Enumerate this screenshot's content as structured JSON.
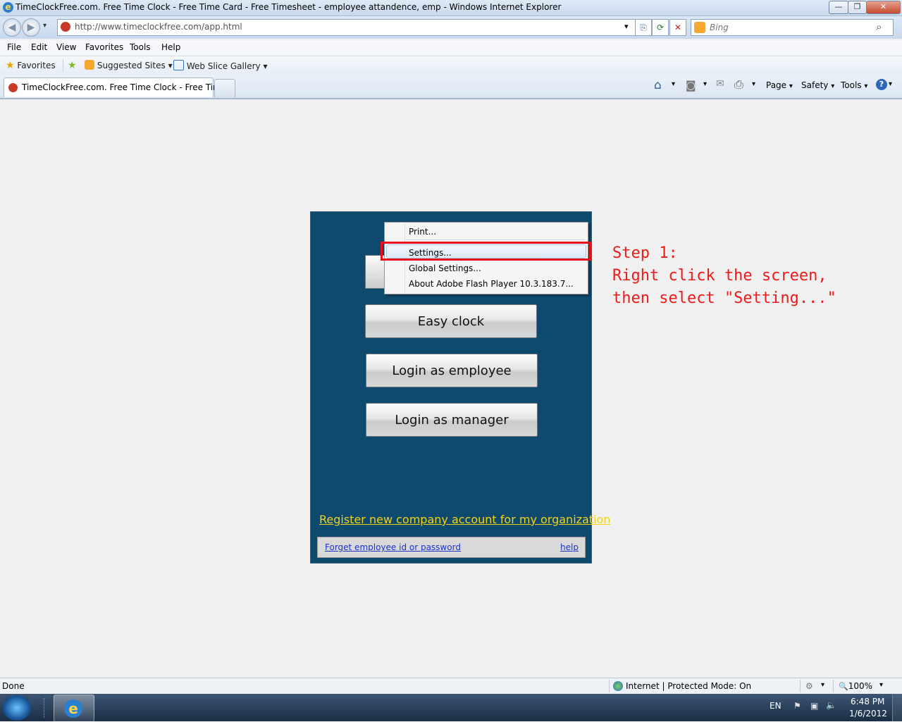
{
  "window": {
    "title": "TimeClockFree.com. Free Time Clock - Free Time Card - Free Timesheet - employee attandence, emp - Windows Internet Explorer",
    "ie_glyph": "e",
    "minimize": "—",
    "maximize": "❐",
    "close": "✕"
  },
  "address_bar": {
    "back": "◀",
    "forward": "▶",
    "history": "▾",
    "url": "http://www.timeclockfree.com/app.html",
    "dropdown": "▾",
    "compat": "⎘",
    "refresh": "⟳",
    "stop": "✕",
    "search_placeholder": "Bing",
    "search_glyph": "⌕"
  },
  "menu": [
    "File",
    "Edit",
    "View",
    "Favorites",
    "Tools",
    "Help"
  ],
  "favorites_bar": {
    "favorites": "Favorites",
    "suggested_sites": "Suggested Sites",
    "web_slice_gallery": "Web Slice Gallery",
    "caret": "▾"
  },
  "tab": {
    "title": "TimeClockFree.com. Free Time Clock - Free Time..."
  },
  "command_bar": {
    "page": "Page",
    "safety": "Safety",
    "tools": "Tools",
    "home_glyph": "⌂",
    "feeds_glyph": "◙",
    "mail_glyph": "✉",
    "print_glyph": "⎙",
    "help_glyph": "?",
    "caret": "▾"
  },
  "app": {
    "easy_clock": "Easy clock",
    "login_employee": "Login as employee",
    "login_manager": "Login as manager",
    "register": "Register new company account for my organization",
    "forget": "Forget employee id or password",
    "help": "help"
  },
  "context_menu": {
    "items": [
      "Print...",
      "Settings...",
      "Global Settings...",
      "About Adobe Flash Player 10.3.183.7..."
    ]
  },
  "annotation": {
    "line1": "Step 1:",
    "line2": "Right click the screen,",
    "line3": "then select \"Setting...\""
  },
  "status_bar": {
    "done": "Done",
    "zone": "Internet | Protected Mode: On",
    "zoom": "100%",
    "zoom_glyph": "🔍",
    "caret": "▾"
  },
  "taskbar": {
    "language": "EN",
    "time": "6:48 PM",
    "date": "1/6/2012",
    "ie_glyph": "e",
    "flag_glyph": "⚑",
    "network_glyph": "▣",
    "volume_glyph": "🔈"
  }
}
